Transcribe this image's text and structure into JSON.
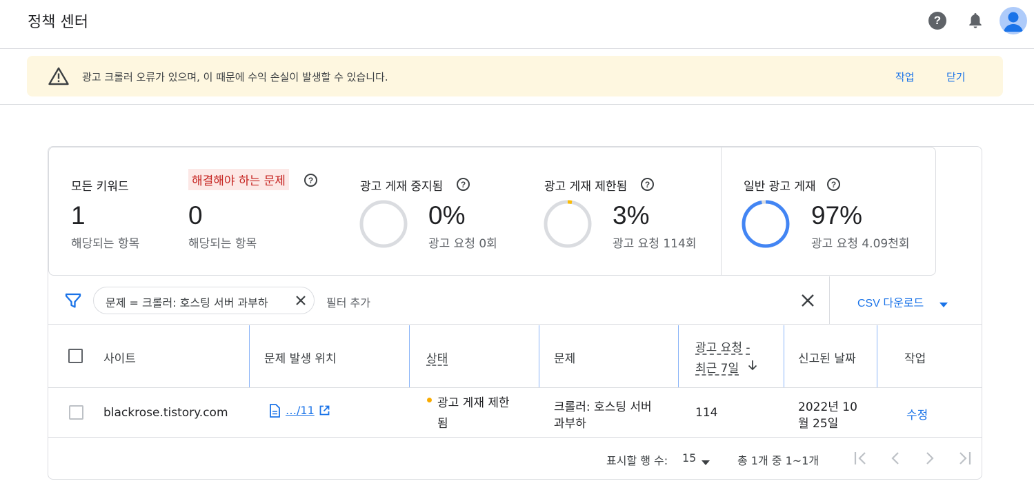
{
  "header": {
    "title": "정책 센터",
    "icons": [
      "help-icon",
      "bell-icon",
      "account-avatar-icon"
    ]
  },
  "banner": {
    "message": "광고 크롤러 오류가 있으며, 이 때문에 수익 손실이 발생할 수 있습니다.",
    "action_label": "작업",
    "dismiss_label": "닫기"
  },
  "stats": {
    "all_keywords": {
      "label": "모든 키워드",
      "value": "1",
      "sub": "해당되는 항목"
    },
    "issues": {
      "label": "해결해야 하는 문제",
      "value": "0",
      "sub": "해당되는 항목"
    },
    "disabled": {
      "label": "광고 게재 중지됨",
      "value": "0%",
      "sub": "광고 요청 0회",
      "fraction": 0.0
    },
    "restricted": {
      "label": "광고 게재 제한됨",
      "value": "3%",
      "sub": "광고 요청 114회",
      "fraction": 0.03,
      "color": "#fbbc04"
    },
    "normal": {
      "label": "일반 광고 게재",
      "value": "97%",
      "sub": "광고 요청 4.09천회",
      "fraction": 0.97,
      "color": "#4285f4"
    }
  },
  "filter": {
    "chip_label": "문제 = 크롤러: 호스팅 서버 과부하",
    "add_placeholder": "필터 추가",
    "csv_label": "CSV 다운로드"
  },
  "table": {
    "columns": {
      "site": "사이트",
      "location": "문제 발생 위치",
      "status": "상태",
      "issue": "문제",
      "requests_l1": "광고 요청 -",
      "requests_l2": "최근 7일",
      "reported": "신고된 날짜",
      "action": "작업"
    },
    "rows": [
      {
        "site": "blackrose.tistory.com",
        "location": "…/11",
        "status_l1": "광고 게재 제한",
        "status_l2": "됨",
        "status_color": "#f9ab00",
        "issue_l1": "크롤러: 호스팅 서버",
        "issue_l2": "과부하",
        "requests": "114",
        "date_l1": "2022년 10",
        "date_l2": "월 25일",
        "action": "수정"
      }
    ]
  },
  "pagination": {
    "rows_label": "표시할 행 수:",
    "rows_value": "15",
    "range_label": "총 1개 중 1~1개"
  }
}
